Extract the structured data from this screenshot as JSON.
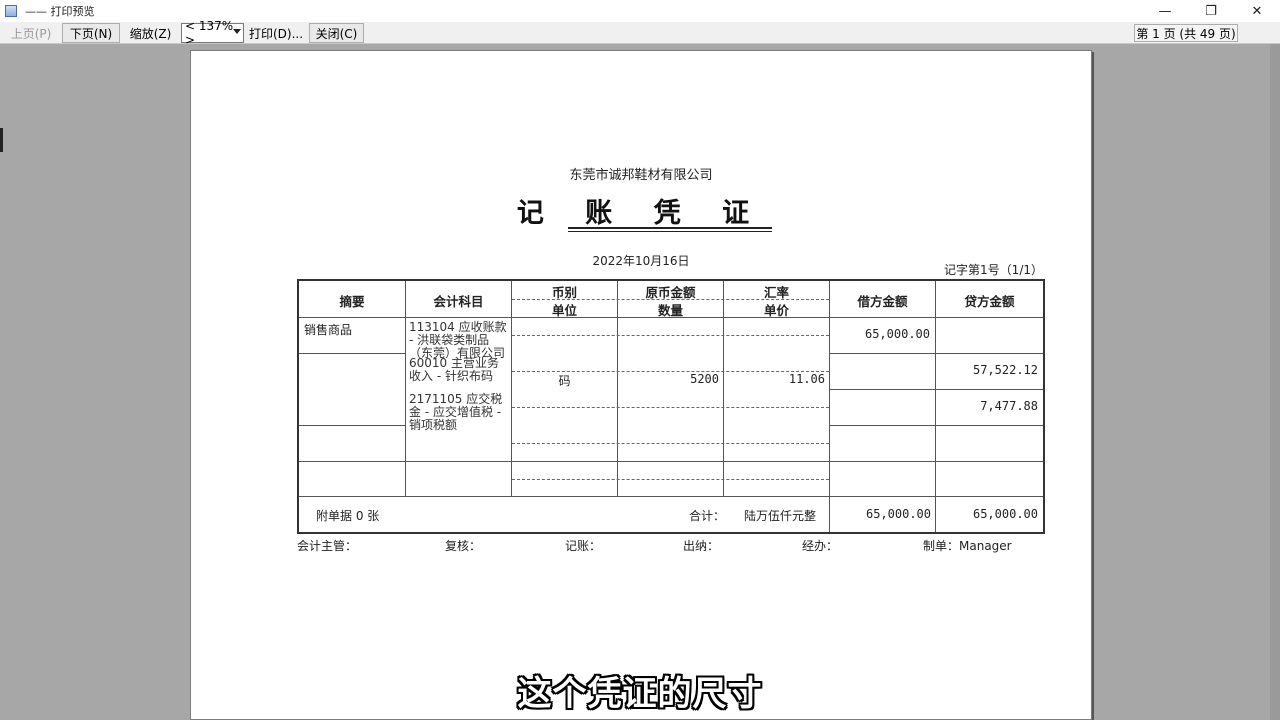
{
  "window": {
    "title": "—— 打印预览",
    "minimize": "—",
    "restore": "❐",
    "close": "✕"
  },
  "toolbar": {
    "prev": "上页(P)",
    "next": "下页(N)",
    "zoom": "缩放(Z)",
    "zoom_value": "< 137% >",
    "print": "打印(D)...",
    "close": "关闭(C)",
    "page_indicator": "第 1 页 (共 49 页)"
  },
  "voucher": {
    "company": "东莞市诚邦鞋材有限公司",
    "title": "记 账 凭 证",
    "date": "2022年10月16日",
    "number": "记字第1号（1/1）",
    "headers": {
      "summary": "摘要",
      "account": "会计科目",
      "currency": "币别",
      "unit": "单位",
      "orig_amount": "原币金额",
      "quantity": "数量",
      "rate": "汇率",
      "unit_price": "单价",
      "debit": "借方金额",
      "credit": "贷方金额"
    },
    "rows": [
      {
        "summary": "销售商品",
        "account": "113104 应收账款 - 洪联袋类制品（东莞）有限公司",
        "unit": "",
        "quantity": "",
        "unit_price": "",
        "debit": "65,000.00",
        "credit": ""
      },
      {
        "summary": "",
        "account": "60010 主营业务收入 - 针织布码",
        "unit": "码",
        "quantity": "5200",
        "unit_price": "11.06",
        "debit": "",
        "credit": "57,522.12"
      },
      {
        "summary": "",
        "account": "2171105 应交税金 - 应交增值税 - 销项税额",
        "unit": "",
        "quantity": "",
        "unit_price": "",
        "debit": "",
        "credit": "7,477.88"
      },
      {
        "summary": "",
        "account": "",
        "unit": "",
        "quantity": "",
        "unit_price": "",
        "debit": "",
        "credit": ""
      },
      {
        "summary": "",
        "account": "",
        "unit": "",
        "quantity": "",
        "unit_price": "",
        "debit": "",
        "credit": ""
      }
    ],
    "attachments": "附单据 0 张",
    "total_label": "合计：",
    "total_words": "陆万伍仟元整",
    "total_debit": "65,000.00",
    "total_credit": "65,000.00",
    "signers": {
      "supervisor": "会计主管：",
      "reviewer": "复核：",
      "bookkeeper": "记账：",
      "cashier": "出纳：",
      "handler": "经办：",
      "maker": "制单：Manager"
    }
  },
  "caption": "这个凭证的尺寸"
}
